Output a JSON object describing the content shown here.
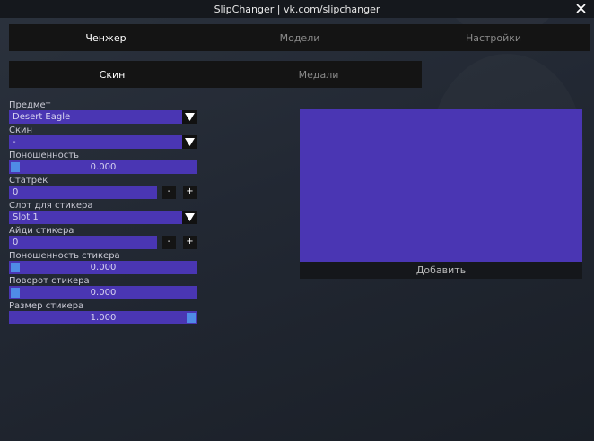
{
  "window": {
    "title": "SlipChanger | vk.com/slipchanger"
  },
  "main_tabs": [
    {
      "label": "Ченжер",
      "active": true
    },
    {
      "label": "Модели",
      "active": false
    },
    {
      "label": "Настройки",
      "active": false
    }
  ],
  "sub_tabs": [
    {
      "label": "Скин",
      "active": true
    },
    {
      "label": "Медали",
      "active": false
    }
  ],
  "form": {
    "item": {
      "label": "Предмет",
      "value": "Desert Eagle"
    },
    "skin": {
      "label": "Скин",
      "value": "-"
    },
    "wear": {
      "label": "Поношенность",
      "value": "0.000",
      "fraction": 0.0
    },
    "stattrak": {
      "label": "Статрек",
      "value": "0",
      "minus": "-",
      "plus": "+"
    },
    "sticker_slot": {
      "label": "Слот для стикера",
      "value": "Slot 1"
    },
    "sticker_id": {
      "label": "Айди стикера",
      "value": "0",
      "minus": "-",
      "plus": "+"
    },
    "sticker_wear": {
      "label": "Поношенность стикера",
      "value": "0.000",
      "fraction": 0.0
    },
    "sticker_rotation": {
      "label": "Поворот стикера",
      "value": "0.000",
      "fraction": 0.0
    },
    "sticker_scale": {
      "label": "Размер стикера",
      "value": "1.000",
      "fraction": 1.0
    }
  },
  "preview": {
    "add_label": "Добавить"
  },
  "colors": {
    "accent": "#4a36b3",
    "grab": "#4f8be6",
    "tabbar": "#141414"
  },
  "icons": {
    "close": "close-icon",
    "dropdown": "triangle-down-icon"
  }
}
